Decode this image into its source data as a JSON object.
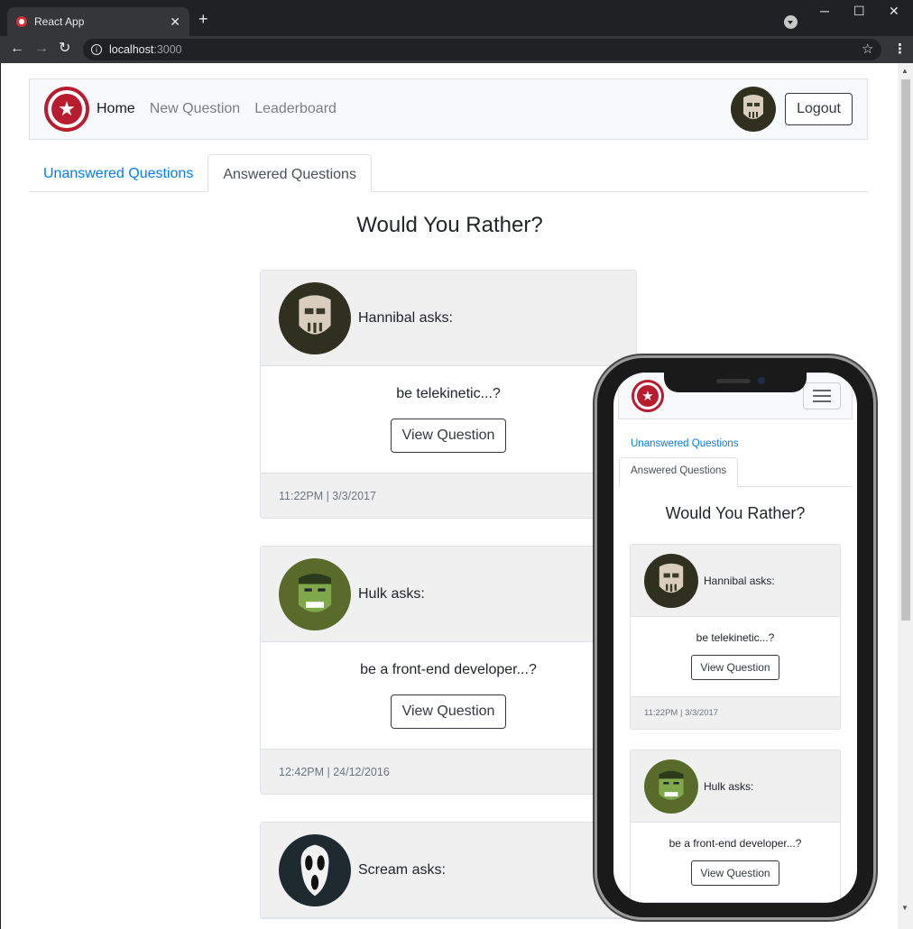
{
  "browser": {
    "tab_title": "React App",
    "new_tab": "+",
    "url_host": "localhost",
    "url_port": ":3000",
    "close_tab": "✕",
    "win_min": "─",
    "win_max": "☐",
    "win_close": "✕",
    "back": "←",
    "forward": "→",
    "reload": "↻",
    "info": "i",
    "star": "☆",
    "menu": "⋮"
  },
  "navbar": {
    "brand_icon": "star-shield-icon",
    "brand_glyph": "★",
    "links": [
      "Home",
      "New Question",
      "Leaderboard"
    ],
    "active_link": "Home",
    "logout": "Logout"
  },
  "tabs": {
    "unanswered": "Unanswered Questions",
    "answered": "Answered Questions"
  },
  "title": "Would You Rather?",
  "cards": [
    {
      "author": "Hannibal asks:",
      "glyph": "☠",
      "question": "be telekinetic...?",
      "button": "View Question",
      "timestamp": "11:22PM | 3/3/2017"
    },
    {
      "author": "Hulk asks:",
      "glyph": "☹",
      "question": "be a front-end developer...?",
      "button": "View Question",
      "timestamp": "12:42PM | 24/12/2016"
    },
    {
      "author": "Scream asks:",
      "glyph": "☻"
    }
  ],
  "mobile": {
    "tab_unanswered": "Unanswered Questions",
    "tab_answered": "Answered Questions",
    "title": "Would You Rather?",
    "cards": [
      {
        "author": "Hannibal asks:",
        "question": "be telekinetic...?",
        "button": "View Question",
        "timestamp": "11:22PM | 3/3/2017"
      },
      {
        "author": "Hulk asks:",
        "question": "be a front-end developer...?",
        "button": "View Question"
      }
    ]
  },
  "colors": {
    "brand_red": "#b71c2f",
    "link_blue": "#007bff"
  }
}
